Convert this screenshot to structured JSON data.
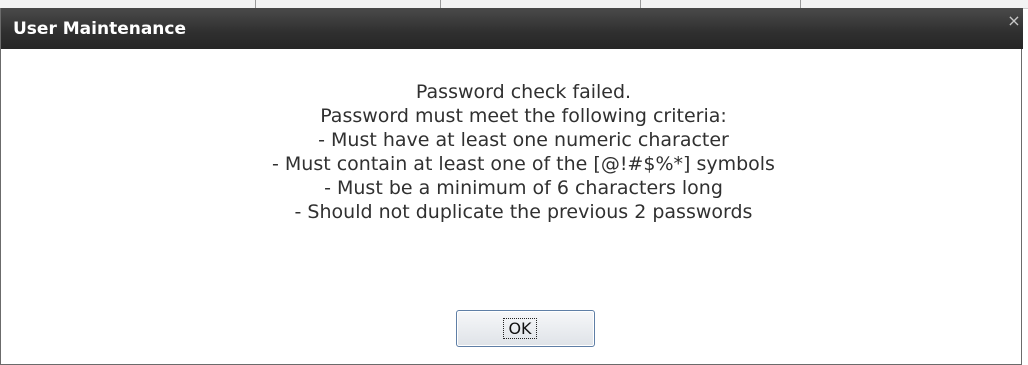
{
  "dialog": {
    "title": "User Maintenance",
    "close_glyph": "×",
    "message_lines": [
      "Password check failed.",
      "Password must meet the following criteria:",
      "- Must have at least one numeric character",
      "- Must contain at least one of the [@!#$%*] symbols",
      "- Must be a minimum of 6 characters long",
      "- Should not duplicate the previous 2 passwords"
    ],
    "ok_label": "OK"
  },
  "colors": {
    "titlebar": "#2f2f2f",
    "title_text": "#ffffff",
    "message_text": "#303030",
    "button_border": "#5f7fa6"
  },
  "icons": {
    "close": "close-icon"
  }
}
